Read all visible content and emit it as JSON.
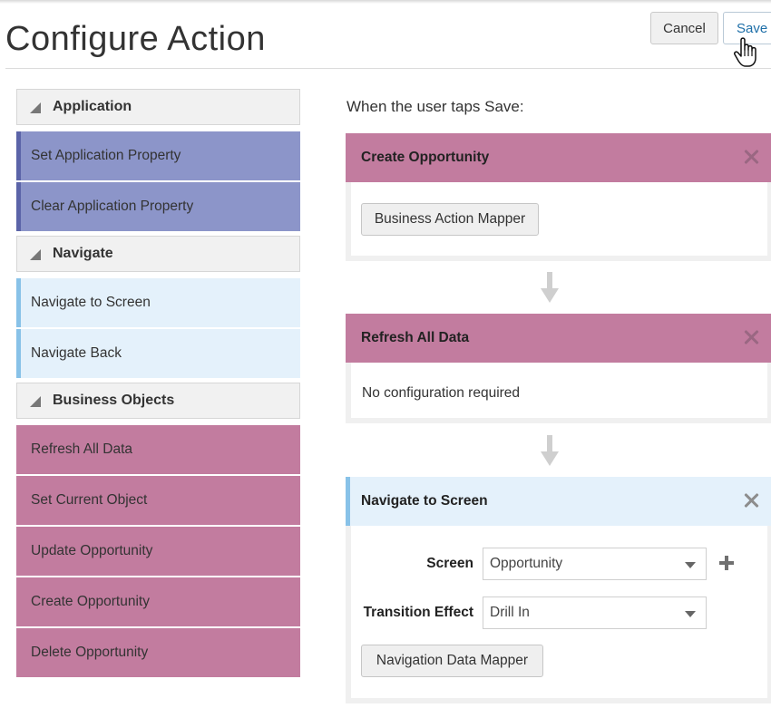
{
  "page": {
    "title": "Configure Action"
  },
  "header": {
    "cancel_label": "Cancel",
    "save_label": "Save"
  },
  "palette": {
    "groups": [
      {
        "label": "Application",
        "items": [
          {
            "label": "Set Application Property"
          },
          {
            "label": "Clear Application Property"
          }
        ]
      },
      {
        "label": "Navigate",
        "items": [
          {
            "label": "Navigate to Screen"
          },
          {
            "label": "Navigate Back"
          }
        ]
      },
      {
        "label": "Business Objects",
        "items": [
          {
            "label": "Refresh All Data"
          },
          {
            "label": "Set Current Object"
          },
          {
            "label": "Update Opportunity"
          },
          {
            "label": "Create Opportunity"
          },
          {
            "label": "Delete Opportunity"
          }
        ]
      }
    ]
  },
  "flow": {
    "intro": "When the user taps Save:",
    "steps": [
      {
        "title": "Create Opportunity",
        "button_label": "Business Action Mapper"
      },
      {
        "title": "Refresh All Data",
        "body_text": "No configuration required"
      },
      {
        "title": "Navigate to Screen",
        "screen_label": "Screen",
        "screen_value": "Opportunity",
        "transition_label": "Transition Effect",
        "transition_value": "Drill In",
        "button_label": "Navigation Data Mapper"
      }
    ]
  },
  "icons": {
    "collapse": "triangle-collapse-icon",
    "close": "close-icon",
    "flow_arrow": "arrow-down-icon",
    "add": "plus-icon",
    "dropdown": "chevron-down-icon",
    "cursor": "hand-pointer-icon"
  },
  "colors": {
    "application": "#8c95c9",
    "navigate": "#e4f1fb",
    "business_objects": "#c27c9f"
  }
}
